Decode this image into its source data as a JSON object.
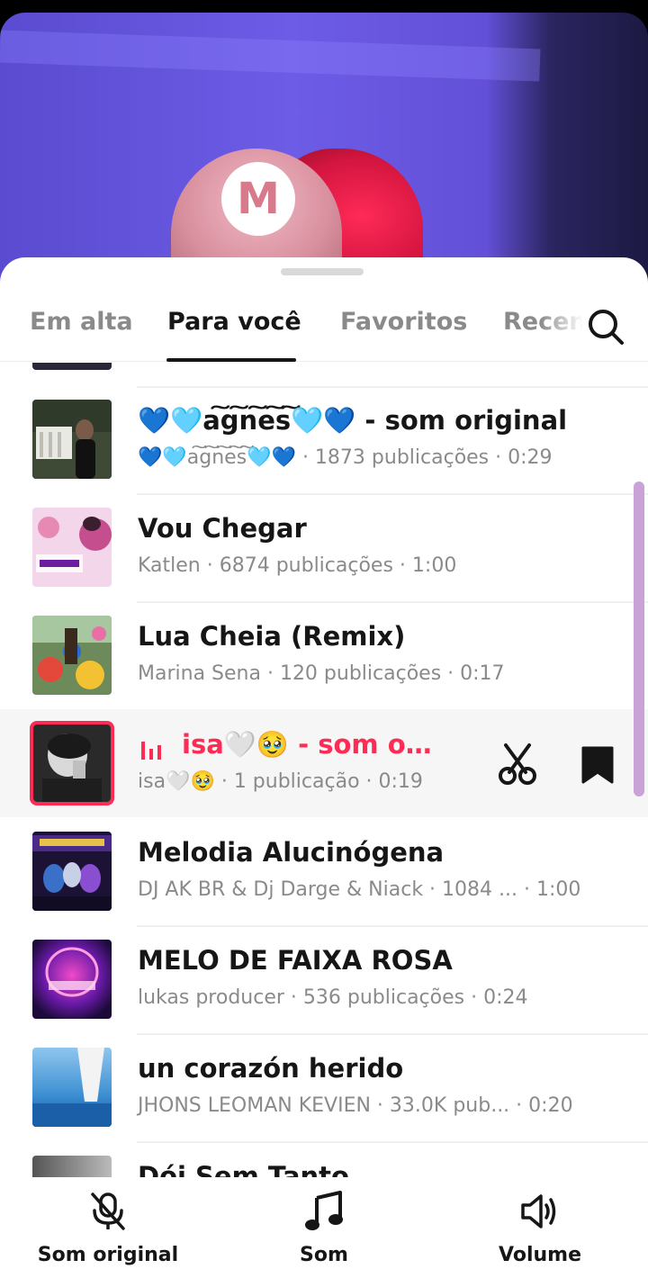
{
  "tabs": [
    {
      "label": "Em alta"
    },
    {
      "label": "Para você"
    },
    {
      "label": "Favoritos"
    },
    {
      "label": "Recen"
    }
  ],
  "video": {
    "cap_logo": "M"
  },
  "tracks": [
    {
      "title": "💙🩵a͠g͠n͠e͠s͠🩵💙 - som original",
      "meta": "💙🩵a͠g͠n͠e͠s͠🩵💙 · 1873 publicações · 0:29"
    },
    {
      "title": "Vou Chegar",
      "meta": "Katlen · 6874 publicações · 1:00"
    },
    {
      "title": "Lua Cheia (Remix)",
      "meta": "Marina Sena · 120 publicações · 0:17"
    },
    {
      "title": "isa🤍🥹 - som ori...",
      "meta": "isa🤍🥹 · 1 publicação · 0:19"
    },
    {
      "title": "Melodia Alucinógena",
      "meta": "DJ AK BR & Dj Darge & Niack · 1084 ...  · 1:00"
    },
    {
      "title": "MELO DE FAIXA ROSA",
      "meta": "lukas producer · 536 publicações · 0:24"
    },
    {
      "title": "un corazón herido",
      "meta": "JHONS LEOMAN KEVIEN · 33.0K pub...  · 0:20"
    },
    {
      "title": "Dói Sem Tanto",
      "meta": ""
    }
  ],
  "bottom_bar": {
    "original_sound": "Som original",
    "sound": "Som",
    "volume": "Volume"
  },
  "colors": {
    "accent": "#fe2c55",
    "scrollbar": "#c9a3d8"
  }
}
